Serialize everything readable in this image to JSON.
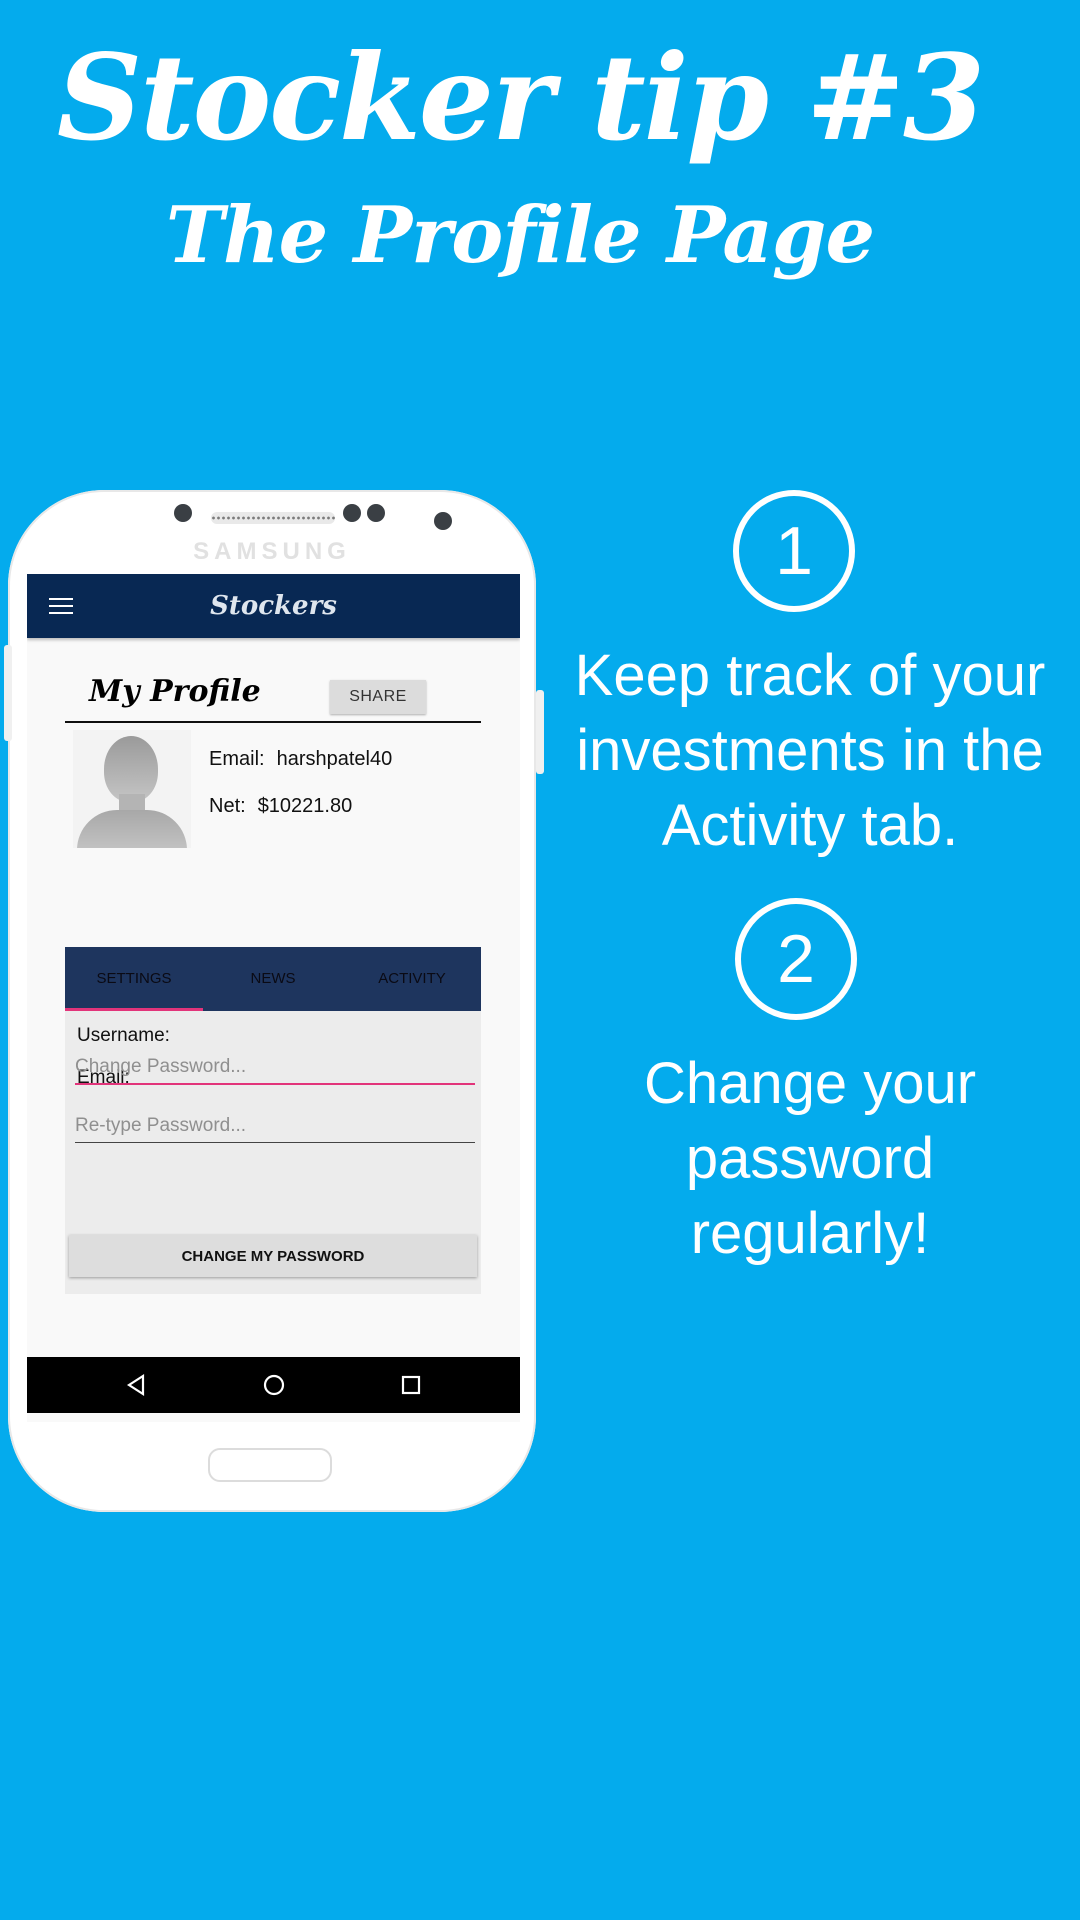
{
  "header": {
    "title": "Stocker tip #3",
    "subtitle": "The Profile Page"
  },
  "phone": {
    "brand": "SAMSUNG",
    "app_bar": {
      "title": "Stockers",
      "menu_icon": "hamburger-menu-icon"
    },
    "profile": {
      "heading": "My Profile",
      "share_label": "SHARE",
      "avatar_icon": "default-user-avatar",
      "email_label": "Email:",
      "email_value": "harshpatel40",
      "net_label": "Net:",
      "net_value": "$10221.80"
    },
    "tabs": [
      {
        "label": "SETTINGS",
        "selected": true
      },
      {
        "label": "NEWS",
        "selected": false
      },
      {
        "label": "ACTIVITY",
        "selected": false
      }
    ],
    "settings": {
      "username_label": "Username:",
      "email_label": "Email:",
      "change_password_placeholder": "Change Password...",
      "retype_password_placeholder": "Re-type Password...",
      "change_button_label": "CHANGE MY PASSWORD"
    },
    "nav_bar": {
      "icons": [
        "back-icon",
        "home-icon",
        "recents-icon"
      ]
    }
  },
  "tips": [
    {
      "number": "1",
      "text": "Keep track of your\ninvestments in the\nActivity tab."
    },
    {
      "number": "2",
      "text": "Change your\npassword\nregularly!"
    }
  ],
  "colors": {
    "background": "#04abed",
    "app_bar": "#082853",
    "tab_bar": "#1e355e",
    "accent": "#e2347a"
  }
}
